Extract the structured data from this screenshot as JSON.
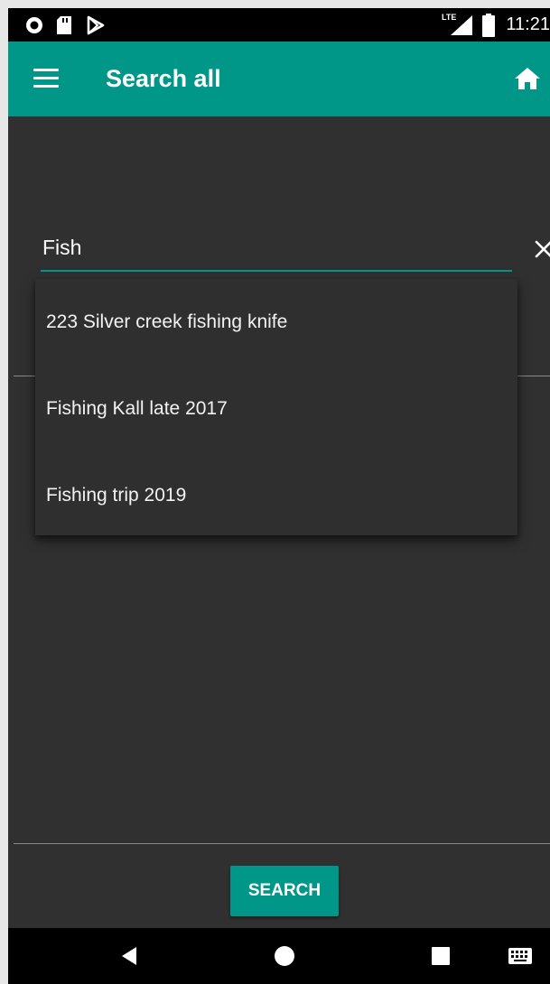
{
  "status_bar": {
    "time": "11:21",
    "network_label": "LTE",
    "icons": [
      "record-icon",
      "sd-card-icon",
      "play-store-icon",
      "lte-signal-icon",
      "battery-icon"
    ]
  },
  "app_bar": {
    "title": "Search all",
    "icons": [
      "menu-icon",
      "home-icon"
    ]
  },
  "search": {
    "value": "Fish",
    "clear_icon": "close-icon"
  },
  "suggestions": [
    {
      "label": "223 Silver creek fishing knife"
    },
    {
      "label": "Fishing Kall late 2017"
    },
    {
      "label": "Fishing trip 2019"
    }
  ],
  "search_button": {
    "label": "SEARCH"
  },
  "nav_bar": {
    "icons": [
      "back-icon",
      "home-circle-icon",
      "recents-icon",
      "keyboard-icon"
    ]
  },
  "colors": {
    "accent": "#009688",
    "background": "#303030",
    "status_bar": "#000000"
  }
}
